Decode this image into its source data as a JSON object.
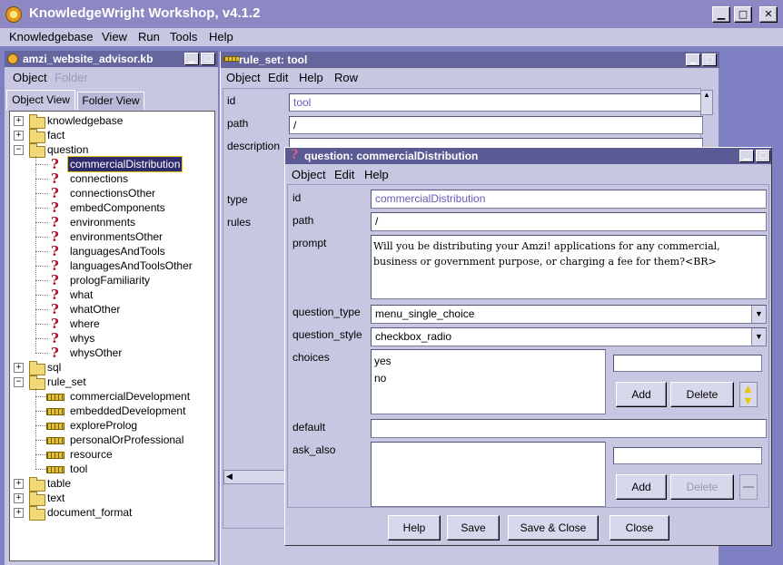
{
  "app": {
    "title": "KnowledgeWright Workshop, v4.1.2"
  },
  "menubar": [
    "Knowledgebase",
    "View",
    "Run",
    "Tools",
    "Help"
  ],
  "kb_window": {
    "title": "amzi_website_advisor.kb",
    "menus": [
      "Object",
      "Folder"
    ],
    "tabs": [
      "Object View",
      "Folder View"
    ],
    "tree": [
      {
        "label": "knowledgebase",
        "kind": "folder",
        "level": 0,
        "expander": "+"
      },
      {
        "label": "fact",
        "kind": "folder",
        "level": 0,
        "expander": "+"
      },
      {
        "label": "question",
        "kind": "folder",
        "level": 0,
        "expander": "-"
      },
      {
        "label": "commercialDistribution",
        "kind": "question",
        "level": 1,
        "selected": true
      },
      {
        "label": "connections",
        "kind": "question",
        "level": 1
      },
      {
        "label": "connectionsOther",
        "kind": "question",
        "level": 1
      },
      {
        "label": "embedComponents",
        "kind": "question",
        "level": 1
      },
      {
        "label": "environments",
        "kind": "question",
        "level": 1
      },
      {
        "label": "environmentsOther",
        "kind": "question",
        "level": 1
      },
      {
        "label": "languagesAndTools",
        "kind": "question",
        "level": 1
      },
      {
        "label": "languagesAndToolsOther",
        "kind": "question",
        "level": 1
      },
      {
        "label": "prologFamiliarity",
        "kind": "question",
        "level": 1
      },
      {
        "label": "what",
        "kind": "question",
        "level": 1
      },
      {
        "label": "whatOther",
        "kind": "question",
        "level": 1
      },
      {
        "label": "where",
        "kind": "question",
        "level": 1
      },
      {
        "label": "whys",
        "kind": "question",
        "level": 1
      },
      {
        "label": "whysOther",
        "kind": "question",
        "level": 1
      },
      {
        "label": "sql",
        "kind": "folder",
        "level": 0,
        "expander": "+"
      },
      {
        "label": "rule_set",
        "kind": "folder",
        "level": 0,
        "expander": "-"
      },
      {
        "label": "commercialDevelopment",
        "kind": "ruleset",
        "level": 1
      },
      {
        "label": "embeddedDevelopment",
        "kind": "ruleset",
        "level": 1
      },
      {
        "label": "exploreProlog",
        "kind": "ruleset",
        "level": 1
      },
      {
        "label": "personalOrProfessional",
        "kind": "ruleset",
        "level": 1
      },
      {
        "label": "resource",
        "kind": "ruleset",
        "level": 1
      },
      {
        "label": "tool",
        "kind": "ruleset",
        "level": 1
      },
      {
        "label": "table",
        "kind": "folder",
        "level": 0,
        "expander": "+"
      },
      {
        "label": "text",
        "kind": "folder",
        "level": 0,
        "expander": "+"
      },
      {
        "label": "document_format",
        "kind": "folder",
        "level": 0,
        "expander": "+"
      }
    ]
  },
  "ruleset_window": {
    "title": "rule_set: tool",
    "menus": [
      "Object",
      "Edit",
      "Help",
      "Row"
    ],
    "labels": {
      "id": "id",
      "path": "path",
      "description": "description",
      "type": "type",
      "rules": "rules"
    },
    "id_value": "tool",
    "path_value": "/"
  },
  "question_window": {
    "title": "question: commercialDistribution",
    "menus": [
      "Object",
      "Edit",
      "Help"
    ],
    "labels": {
      "id": "id",
      "path": "path",
      "prompt": "prompt",
      "question_type": "question_type",
      "question_style": "question_style",
      "choices": "choices",
      "default": "default",
      "ask_also": "ask_also"
    },
    "id_value": "commercialDistribution",
    "path_value": "/",
    "prompt_value": "Will you be distributing your Amzi! applications for any commercial, business or government purpose, or charging a fee for them?<BR>",
    "question_type_value": "menu_single_choice",
    "question_style_value": "checkbox_radio",
    "choices": [
      "yes",
      "no"
    ],
    "default_value": "",
    "buttons": {
      "add": "Add",
      "delete": "Delete"
    },
    "footer_buttons": [
      "Help",
      "Save",
      "Save & Close",
      "Close"
    ]
  },
  "colors": {
    "titlebar": "#8d87c3",
    "frame_title": "#66669e",
    "panel": "#c7c7e2",
    "desktop": "#7f7fc4",
    "id_text": "#6c56b8"
  }
}
